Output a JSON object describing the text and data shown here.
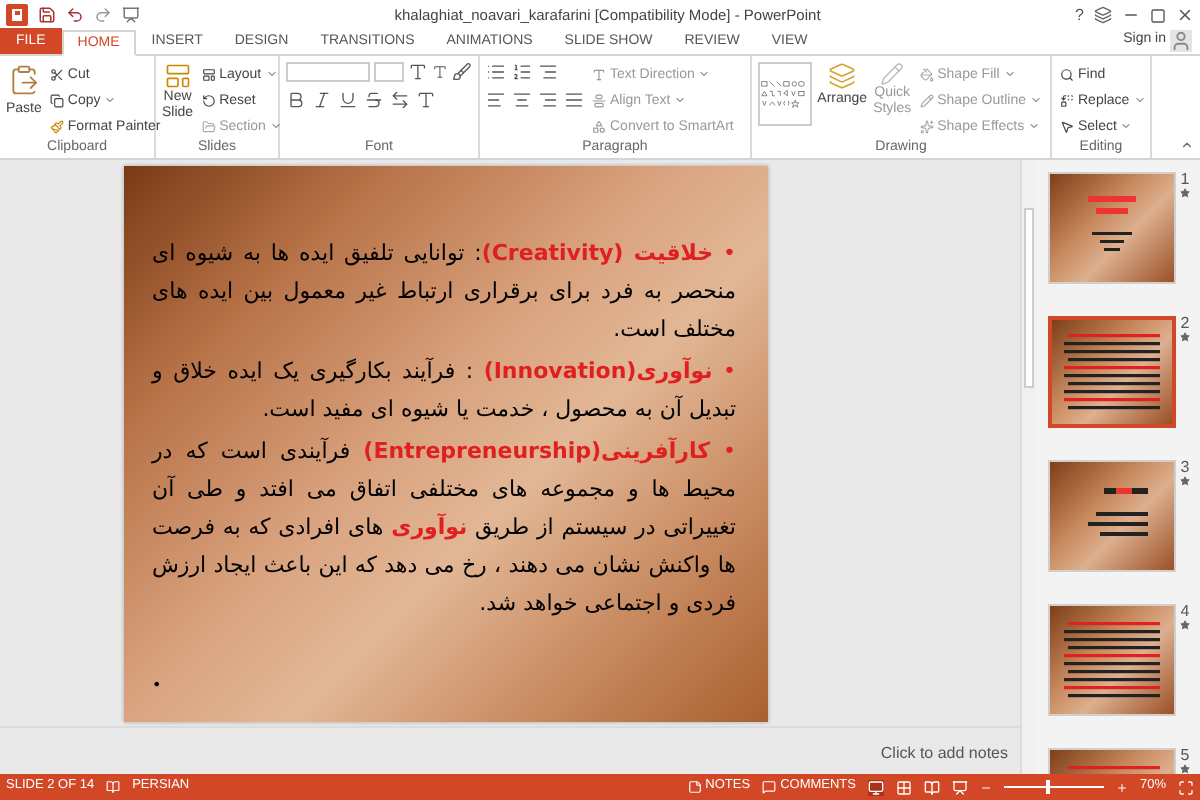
{
  "window": {
    "title": "khalaghiat_noavari_karafarini [Compatibility Mode] - PowerPoint",
    "help": "?"
  },
  "tabs": [
    {
      "label": "FILE",
      "kind": "file",
      "selected": false
    },
    {
      "label": "HOME",
      "kind": "tab",
      "selected": true
    },
    {
      "label": "INSERT",
      "kind": "tab",
      "selected": false
    },
    {
      "label": "DESIGN",
      "kind": "tab",
      "selected": false
    },
    {
      "label": "TRANSITIONS",
      "kind": "tab",
      "selected": false
    },
    {
      "label": "ANIMATIONS",
      "kind": "tab",
      "selected": false
    },
    {
      "label": "SLIDE SHOW",
      "kind": "tab",
      "selected": false
    },
    {
      "label": "REVIEW",
      "kind": "tab",
      "selected": false
    },
    {
      "label": "VIEW",
      "kind": "tab",
      "selected": false
    }
  ],
  "sign_in": "Sign in",
  "ribbon": {
    "clipboard": {
      "label": "Clipboard",
      "paste": "Paste",
      "cut": "Cut",
      "copy": "Copy",
      "format_painter": "Format Painter"
    },
    "slides": {
      "label": "Slides",
      "new_slide": [
        "New",
        "Slide"
      ],
      "layout": "Layout",
      "reset": "Reset",
      "section": "Section"
    },
    "font": {
      "label": "Font"
    },
    "paragraph": {
      "label": "Paragraph",
      "text_direction": "Text Direction",
      "align_text": "Align Text",
      "convert": "Convert to SmartArt"
    },
    "drawing": {
      "label": "Drawing",
      "arrange": "Arrange",
      "quick_styles": [
        "Quick",
        "Styles"
      ],
      "shape_fill": "Shape Fill",
      "shape_outline": "Shape Outline",
      "shape_effects": "Shape Effects"
    },
    "editing": {
      "label": "Editing",
      "find": "Find",
      "replace": "Replace",
      "select": "Select"
    }
  },
  "slide": {
    "bullets": [
      {
        "kind": "text",
        "marker": "•",
        "segments": [
          {
            "text": "خلاقیت (Creativity)",
            "highlight": true
          },
          {
            "text": ": توانایی  تلفیق  ایده ها به شیوه ای منحصر  به فرد  برای برقراری  ارتباط غیر  معمول بین ایده های مختلف است.",
            "highlight": false
          }
        ]
      },
      {
        "kind": "text",
        "marker": "•",
        "segments": [
          {
            "text": "نوآوری(Innovation)",
            "highlight": true
          },
          {
            "text": " : فرآیند  بکارگیری  یک ایده خلاق و تبدیل آن به محصول ، خدمت یا شیوه ای مفید است.",
            "highlight": false
          }
        ]
      },
      {
        "kind": "text",
        "marker": "•",
        "segments": [
          {
            "text": "کارآفرینی(Entrepreneurship)",
            "highlight": true
          },
          {
            "text": " فرآیندی  است که  در محیط ها و مجموعه های مختلفی اتفاق می افتد و طی آن تغییراتی در  سیستم  از طریق ",
            "highlight": false
          },
          {
            "text": "نوآوری",
            "highlight": true
          },
          {
            "text": " های افرادی که به فرصت ها واکنش نشان می دهند ، رخ می دهد که این باعث ایجاد ارزش فردی و اجتماعی خواهد شد.",
            "highlight": false
          }
        ]
      },
      {
        "kind": "empty",
        "marker": "•"
      }
    ]
  },
  "notes_placeholder": "Click to add notes",
  "thumbnails": [
    {
      "number": "1",
      "selected": false,
      "kind": "title"
    },
    {
      "number": "2",
      "selected": true,
      "kind": "dense"
    },
    {
      "number": "3",
      "selected": false,
      "kind": "list"
    },
    {
      "number": "4",
      "selected": false,
      "kind": "dense"
    },
    {
      "number": "5",
      "selected": false,
      "kind": "dense"
    }
  ],
  "status_bar": {
    "slide": "SLIDE 2 OF 14",
    "language": "PERSIAN",
    "notes": "NOTES",
    "comments": "COMMENTS",
    "zoom": "70%",
    "zoom_slider": {
      "level": 0.45
    }
  }
}
